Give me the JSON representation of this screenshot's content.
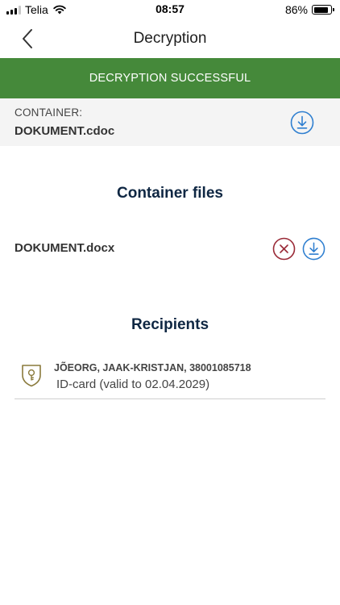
{
  "status_bar": {
    "carrier": "Telia",
    "time": "08:57",
    "battery_percent": "86%",
    "battery_level": 0.86,
    "signal_icon": "cellular-signal-icon",
    "wifi_icon": "wifi-icon",
    "battery_icon": "battery-icon"
  },
  "nav": {
    "title": "Decryption",
    "back_icon": "chevron-left-icon"
  },
  "banner": {
    "text": "DECRYPTION SUCCESSFUL",
    "color": "#45893a"
  },
  "container": {
    "label": "CONTAINER:",
    "name": "DOKUMENT.cdoc",
    "download_icon": "download-icon"
  },
  "files": {
    "title": "Container files",
    "items": [
      {
        "name": "DOKUMENT.docx",
        "remove_icon": "remove-icon",
        "download_icon": "download-icon"
      }
    ]
  },
  "recipients": {
    "title": "Recipients",
    "items": [
      {
        "name": "JÕEORG, JAAK-KRISTJAN, 38001085718",
        "detail": "ID-card (valid to 02.04.2029)",
        "icon": "key-shield-icon"
      }
    ]
  },
  "colors": {
    "accent_blue": "#2f7fd0",
    "remove_red": "#9a2a37",
    "heading_navy": "#0f2743",
    "shield_gold": "#8a7a3c"
  }
}
